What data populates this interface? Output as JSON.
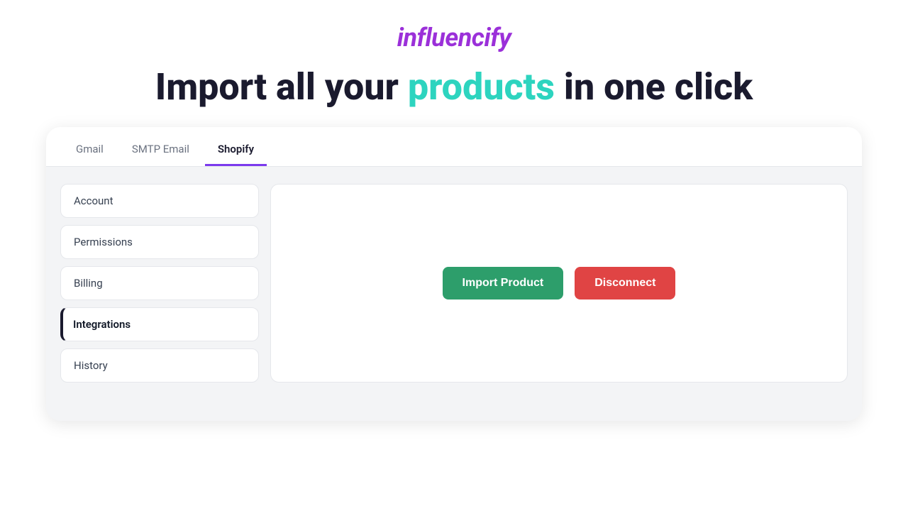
{
  "header": {
    "logo": "influencify"
  },
  "headline": {
    "prefix": "Import all your ",
    "highlight": "products",
    "suffix": " in one click"
  },
  "tabs": [
    {
      "id": "gmail",
      "label": "Gmail",
      "active": false
    },
    {
      "id": "smtp",
      "label": "SMTP Email",
      "active": false
    },
    {
      "id": "shopify",
      "label": "Shopify",
      "active": true
    }
  ],
  "sidebar": {
    "items": [
      {
        "id": "account",
        "label": "Account",
        "active": false
      },
      {
        "id": "permissions",
        "label": "Permissions",
        "active": false
      },
      {
        "id": "billing",
        "label": "Billing",
        "active": false
      },
      {
        "id": "integrations",
        "label": "Integrations",
        "active": true
      },
      {
        "id": "history",
        "label": "History",
        "active": false
      }
    ]
  },
  "panel": {
    "import_button_label": "Import Product",
    "disconnect_button_label": "Disconnect"
  }
}
